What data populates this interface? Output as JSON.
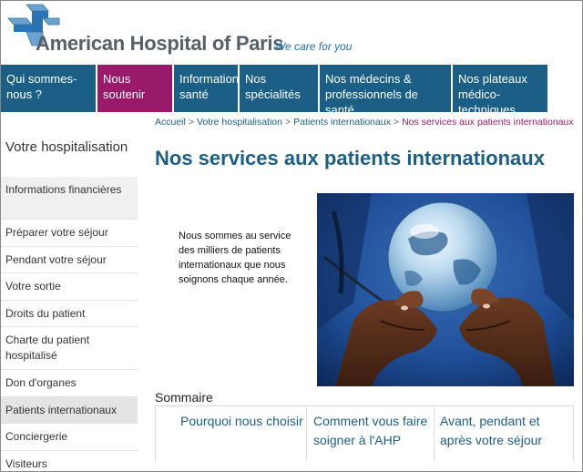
{
  "header": {
    "site_name": "American Hospital of Paris",
    "tagline": "We care for you"
  },
  "nav": {
    "items": [
      {
        "label": "Qui sommes-nous ?"
      },
      {
        "label": "Nous soutenir"
      },
      {
        "label": "Information santé"
      },
      {
        "label": "Nos spécialités"
      },
      {
        "label": "Nos médecins & professionnels de santé"
      },
      {
        "label": "Nos plateaux médico-techniques"
      }
    ]
  },
  "sidebar": {
    "title": "Votre hospitalisation",
    "items": [
      {
        "label": "Informations financières"
      },
      {
        "label": "Préparer votre séjour"
      },
      {
        "label": "Pendant votre séjour"
      },
      {
        "label": "Votre sortie"
      },
      {
        "label": "Droits du patient"
      },
      {
        "label": "Charte du patient hospitalisé"
      },
      {
        "label": "Don d'organes"
      },
      {
        "label": "Patients internationaux"
      },
      {
        "label": "Conciergerie"
      },
      {
        "label": "Visiteurs"
      }
    ]
  },
  "breadcrumb": {
    "items": [
      "Accueil",
      "Votre hospitalisation",
      "Patients internationaux"
    ],
    "current": "Nos services aux patients internationaux",
    "separator": ">"
  },
  "main": {
    "title": "Nos services aux patients internationaux",
    "intro": "Nous sommes au service des milliers de patients internationaux que nous soignons chaque année.",
    "summary_heading": "Sommaire",
    "summary_links": [
      {
        "label": "Pourquoi nous choisir"
      },
      {
        "label": "Comment vous faire soigner à l'AHP"
      },
      {
        "label": "Avant, pendant et après votre séjour"
      }
    ]
  },
  "colors": {
    "nav_blue": "#1b5e86",
    "nav_active": "#99196b",
    "logo_grey": "#56606a",
    "tagline_blue": "#1a74b5"
  },
  "icons": {
    "logo": "hospital-cross-logo",
    "photo": "hands-holding-globe-image"
  }
}
